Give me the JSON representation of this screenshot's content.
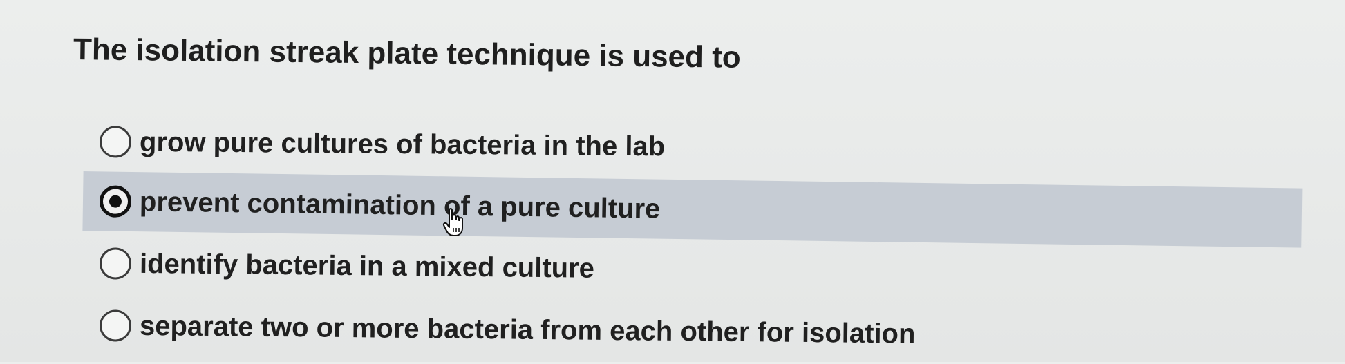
{
  "question": {
    "text": "The isolation streak plate technique is used to"
  },
  "options": [
    {
      "label": "grow pure cultures of bacteria in the lab",
      "selected": false
    },
    {
      "label": "prevent contamination of a pure culture",
      "selected": true
    },
    {
      "label": "identify bacteria in a mixed culture",
      "selected": false
    },
    {
      "label": "separate two or more bacteria from each other for isolation",
      "selected": false
    }
  ],
  "cursor": {
    "icon": "hand-pointer-icon"
  },
  "colors": {
    "selected_background": "#c6ccd4",
    "page_background": "#eceeed",
    "text": "#1f1f1f"
  }
}
